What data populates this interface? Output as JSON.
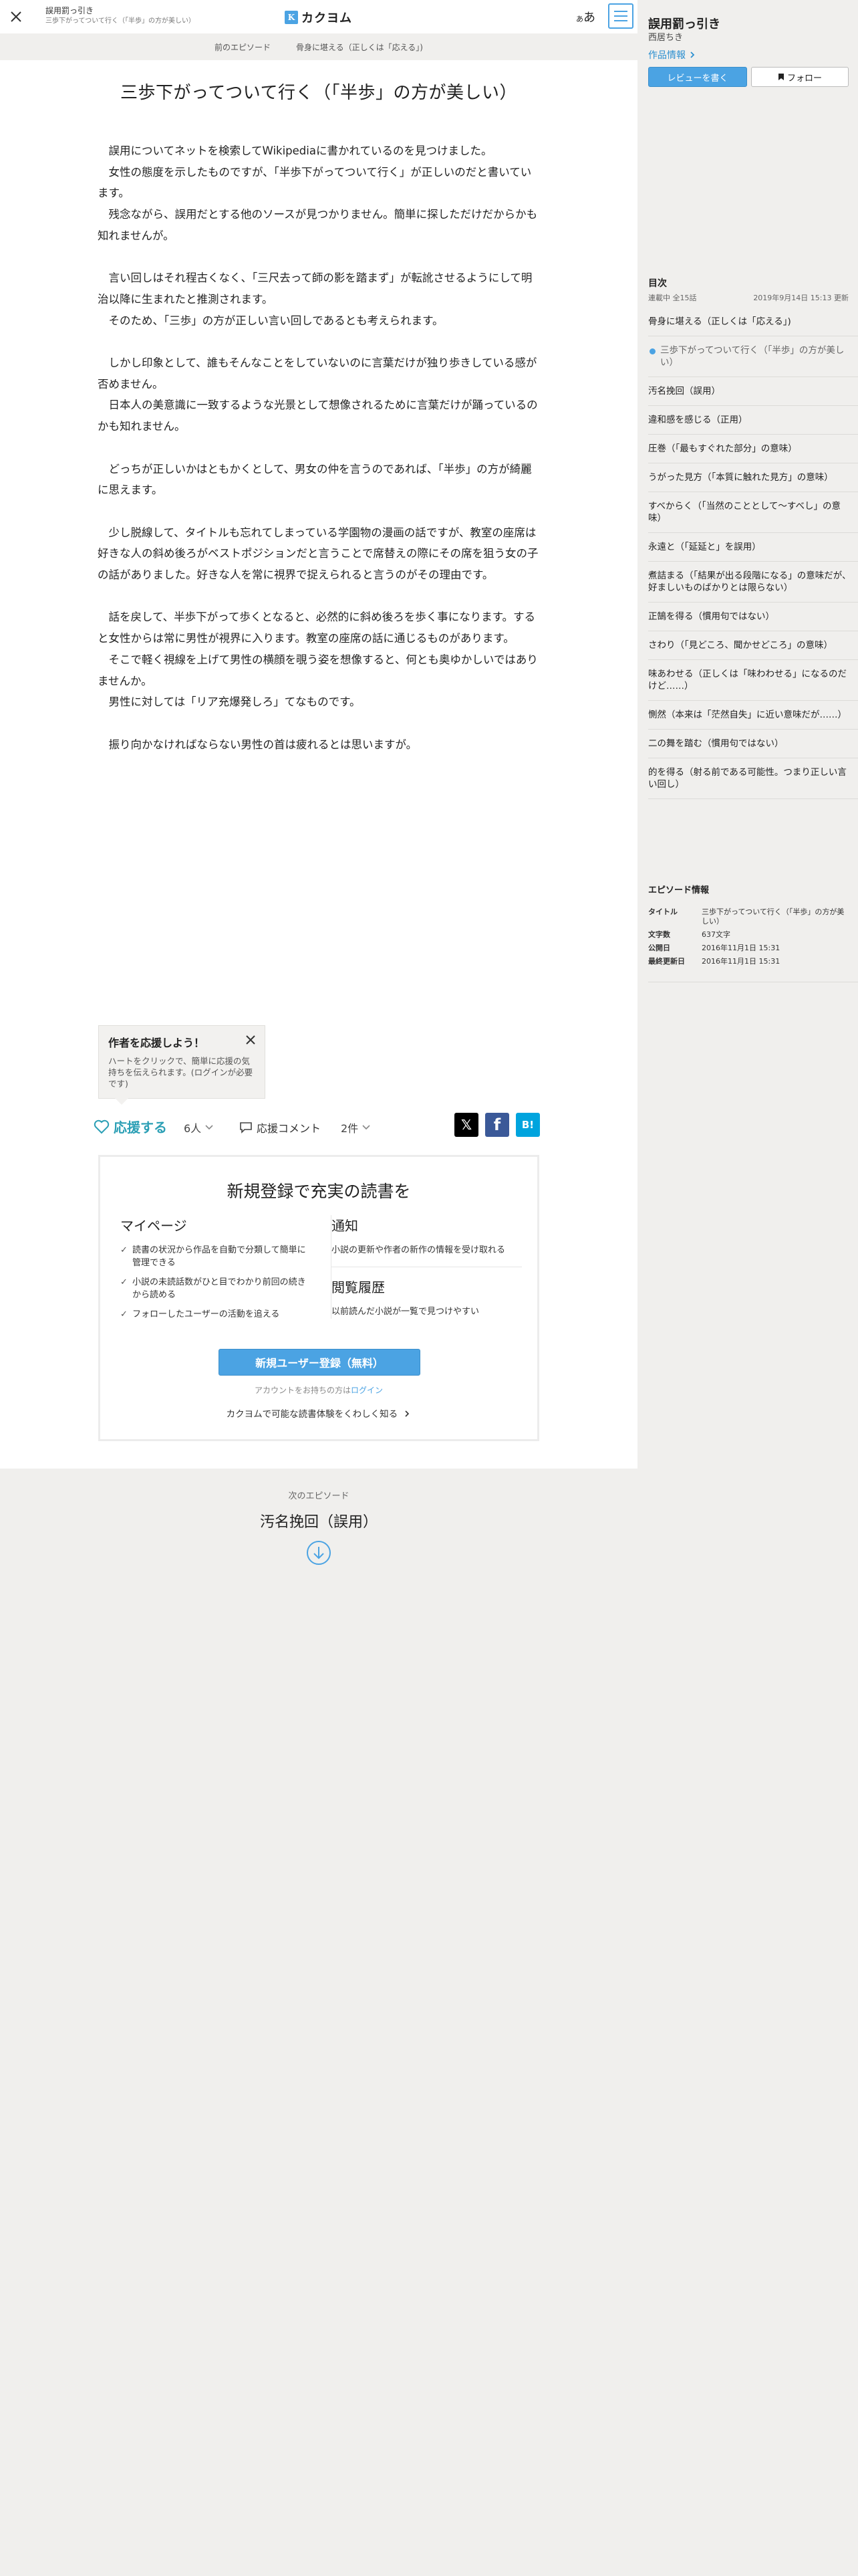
{
  "header": {
    "work_title": "誤用罰っ引き",
    "episode_title": "三歩下がってついて行く（「半歩」の方が美しい）",
    "logo_text": "カクヨム",
    "font_toggle": "あ",
    "font_toggle_small": "あ"
  },
  "prev_bar": {
    "label": "前のエピソード",
    "title": "骨身に堪える（正しくは「応える」)"
  },
  "article": {
    "title": "三歩下がってついて行く（「半歩」の方が美しい）",
    "paragraphs": [
      "誤用についてネットを検索してWikipediaに書かれているのを見つけました。",
      "女性の態度を示したものですが、「半歩下がってついて行く」が正しいのだと書いています。",
      "残念ながら、誤用だとする他のソースが見つかりません。簡単に探しただけだからかも知れませんが。",
      "",
      "言い回しはそれ程古くなく、「三尺去って師の影を踏まず」が転訛させるようにして明治以降に生まれたと推測されます。",
      "そのため、「三歩」の方が正しい言い回しであるとも考えられます。",
      "",
      "しかし印象として、誰もそんなことをしていないのに言葉だけが独り歩きしている感が否めません。",
      "日本人の美意識に一致するような光景として想像されるために言葉だけが踊っているのかも知れません。",
      "",
      "どっちが正しいかはともかくとして、男女の仲を言うのであれば、「半歩」の方が綺麗に思えます。",
      "",
      "少し脱線して、タイトルも忘れてしまっている学園物の漫画の話ですが、教室の座席は好きな人の斜め後ろがベストポジションだと言うことで席替えの際にその席を狙う女の子の話がありました。好きな人を常に視界で捉えられると言うのがその理由です。",
      "",
      "話を戻して、半歩下がって歩くとなると、必然的に斜め後ろを歩く事になります。すると女性からは常に男性が視界に入ります。教室の座席の話に通じるものがあります。",
      "そこで軽く視線を上げて男性の横顔を覗う姿を想像すると、何とも奥ゆかしいではありませんか。",
      "男性に対しては「リア充爆発しろ」てなものです。",
      "",
      "振り向かなければならない男性の首は疲れるとは思いますが。"
    ]
  },
  "tip": {
    "title": "作者を応援しよう！",
    "text": "ハートをクリックで、簡単に応援の気持ちを伝えられます。(ログインが必要です)"
  },
  "actions": {
    "cheer_label": "応援する",
    "cheer_count": "6人",
    "comment_label": "応援コメント",
    "comment_count": "2件",
    "share_x": "𝕏",
    "share_fb": "f",
    "share_hb": "B!"
  },
  "signup": {
    "title": "新規登録で充実の読書を",
    "mypage_head": "マイページ",
    "mypage_items": [
      "読書の状況から作品を自動で分類して簡単に管理できる",
      "小説の未読話数がひと目でわかり前回の続きから読める",
      "フォローしたユーザーの活動を追える"
    ],
    "notify_head": "通知",
    "notify_text": "小説の更新や作者の新作の情報を受け取れる",
    "history_head": "閲覧履歴",
    "history_text": "以前読んだ小説が一覧で見つけやすい",
    "register_label": "新規ユーザー登録（無料）",
    "login_prefix": "アカウントをお持ちの方は",
    "login_link": "ログイン",
    "learn_more": "カクヨムで可能な読書体験をくわしく知る"
  },
  "next": {
    "label": "次のエピソード",
    "title": "汚名挽回（誤用）"
  },
  "sidebar": {
    "work_title": "誤用罰っ引き",
    "author": "西居ちき",
    "work_info": "作品情報",
    "review_label": "レビューを書く",
    "follow_label": "フォロー",
    "toc_head": "目次",
    "toc_status": "連載中 全15話",
    "toc_updated": "2019年9月14日 15:13 更新",
    "toc_items": [
      "骨身に堪える（正しくは「応える」)",
      "三歩下がってついて行く（「半歩」の方が美しい）",
      "汚名挽回（誤用）",
      "違和感を感じる（正用）",
      "圧巻（「最もすぐれた部分」の意味）",
      "うがった見方（「本質に触れた見方」の意味）",
      "すべからく（「当然のこととして〜すべし」の意味）",
      "永遠と（「延延と」を誤用）",
      "煮詰まる（「結果が出る段階になる」の意味だが、好ましいものばかりとは限らない）",
      "正鵠を得る（慣用句ではない）",
      "さわり（「見どころ、聞かせどころ」の意味）",
      "味あわせる（正しくは「味わわせる」になるのだけど……）",
      "惻然（本来は「茫然自失」に近い意味だが……）",
      "二の舞を踏む（慣用句ではない）",
      "的を得る（射る前である可能性。つまり正しい言い回し）"
    ],
    "ep_info": {
      "head": "エピソード情報",
      "rows": [
        {
          "k": "タイトル",
          "v": "三歩下がってついて行く（「半歩」の方が美しい）"
        },
        {
          "k": "文字数",
          "v": "637文字"
        },
        {
          "k": "公開日",
          "v": "2016年11月1日 15:31"
        },
        {
          "k": "最終更新日",
          "v": "2016年11月1日 15:31"
        }
      ]
    }
  },
  "colors": {
    "accent": "#4ba3e3",
    "cheer": "#2b9fb5",
    "background": "#f0efed"
  }
}
